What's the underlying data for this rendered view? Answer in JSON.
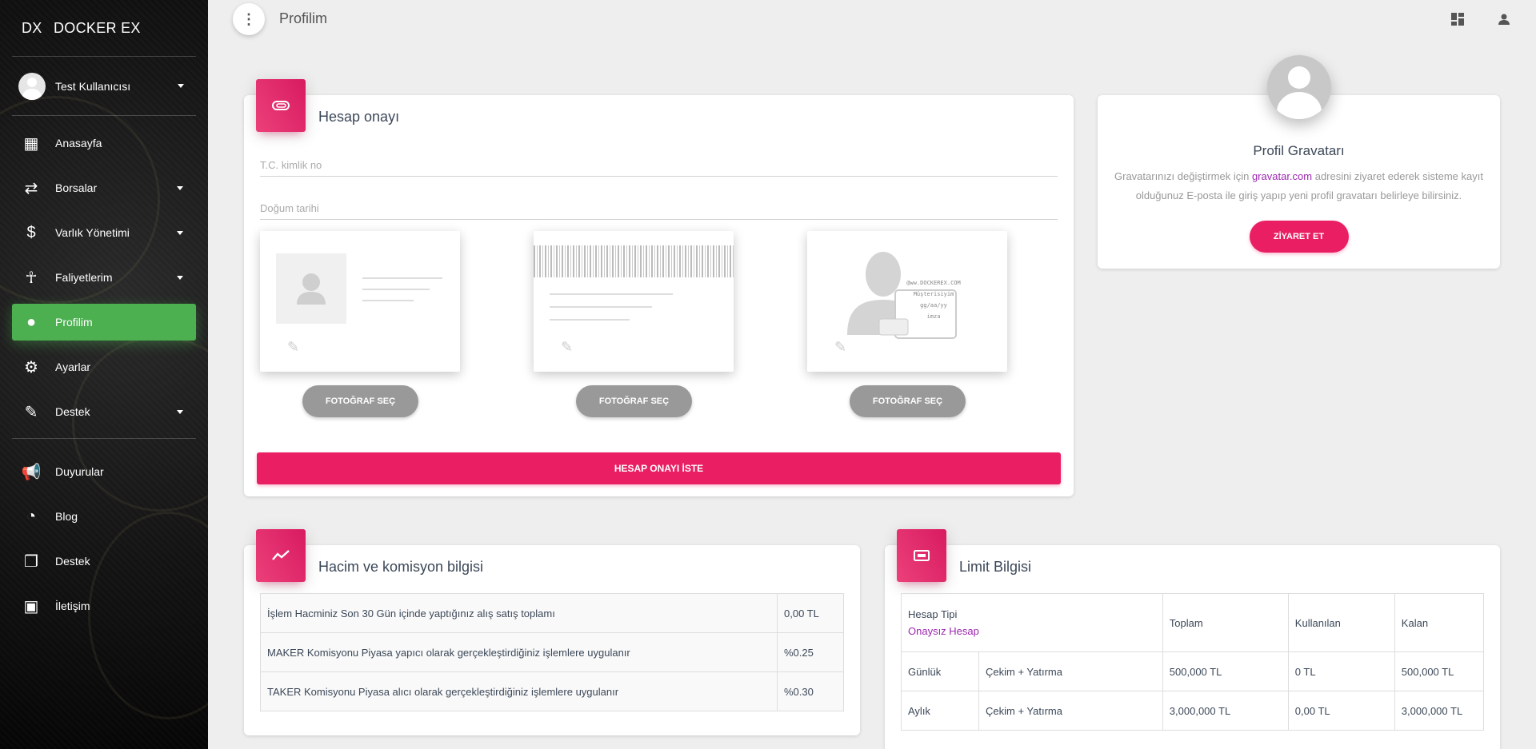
{
  "brand": {
    "mini": "DX",
    "name": "DOCKER EX"
  },
  "user": {
    "name": "Test Kullanıcısı"
  },
  "nav": [
    {
      "label": "Anasayfa",
      "icon": "dashboard-icon",
      "glyph": "▦",
      "caret": false,
      "active": false
    },
    {
      "label": "Borsalar",
      "icon": "swap-icon",
      "glyph": "⇄",
      "caret": true,
      "active": false
    },
    {
      "label": "Varlık Yönetimi",
      "icon": "dollar-icon",
      "glyph": "$",
      "caret": true,
      "active": false
    },
    {
      "label": "Faliyetlerim",
      "icon": "accessibility-icon",
      "glyph": "☥",
      "caret": true,
      "active": false
    },
    {
      "label": "Profilim",
      "icon": "person-icon",
      "glyph": "●",
      "caret": false,
      "active": true
    },
    {
      "label": "Ayarlar",
      "icon": "gear-icon",
      "glyph": "⚙",
      "caret": false,
      "active": false
    },
    {
      "label": "Destek",
      "icon": "ticket-icon",
      "glyph": "✎",
      "caret": true,
      "active": false
    }
  ],
  "nav2": [
    {
      "label": "Duyurular",
      "icon": "megaphone-icon",
      "glyph": "📢"
    },
    {
      "label": "Blog",
      "icon": "rss-icon",
      "glyph": "◔"
    },
    {
      "label": "Destek",
      "icon": "documents-icon",
      "glyph": "❐"
    },
    {
      "label": "İletişim",
      "icon": "contact-card-icon",
      "glyph": "▣"
    }
  ],
  "topbar": {
    "title": "Profilim"
  },
  "verify": {
    "title": "Hesap onayı",
    "tc_label": "T.C. kimlik no",
    "birth_label": "Doğum tarihi",
    "photo_btn": "FOTOĞRAF SEÇ",
    "submit": "HESAP ONAYI İSTE",
    "selfie_note": [
      "@ww.DOCKEREX.COM",
      "Müşterisiyim",
      "gg/aa/yy",
      "imza"
    ]
  },
  "profile": {
    "title": "Profil Gravatarı",
    "desc_pre": "Gravatarınızı değiştirmek için ",
    "link": "gravatar.com",
    "desc_post": " adresini ziyaret ederek sisteme kayıt olduğunuz E-posta ile giriş yapıp yeni profil gravatarı belirleye bilirsiniz.",
    "button": "ZİYARET ET"
  },
  "volume": {
    "title": "Hacim ve komisyon bilgisi",
    "rows": [
      [
        "İşlem Hacminiz Son 30 Gün içinde yaptığınız alış satış toplamı",
        "0,00 TL"
      ],
      [
        "MAKER Komisyonu Piyasa yapıcı olarak gerçekleştirdiğiniz işlemlere uygulanır",
        "%0.25"
      ],
      [
        "TAKER Komisyonu Piyasa alıcı olarak gerçekleştirdiğiniz işlemlere uygulanır",
        "%0.30"
      ]
    ]
  },
  "limit": {
    "title": "Limit Bilgisi",
    "account_type_label": "Hesap Tipi",
    "account_type": "Onaysız Hesap",
    "headers": [
      "Toplam",
      "Kullanılan",
      "Kalan"
    ],
    "rows": [
      [
        "Günlük",
        "Çekim + Yatırma",
        "500,000 TL",
        "0 TL",
        "500,000 TL"
      ],
      [
        "Aylık",
        "Çekim + Yatırma",
        "3,000,000 TL",
        "0,00 TL",
        "3,000,000 TL"
      ]
    ]
  },
  "colors": {
    "accent": "#e91e63",
    "active": "#4caf50"
  }
}
